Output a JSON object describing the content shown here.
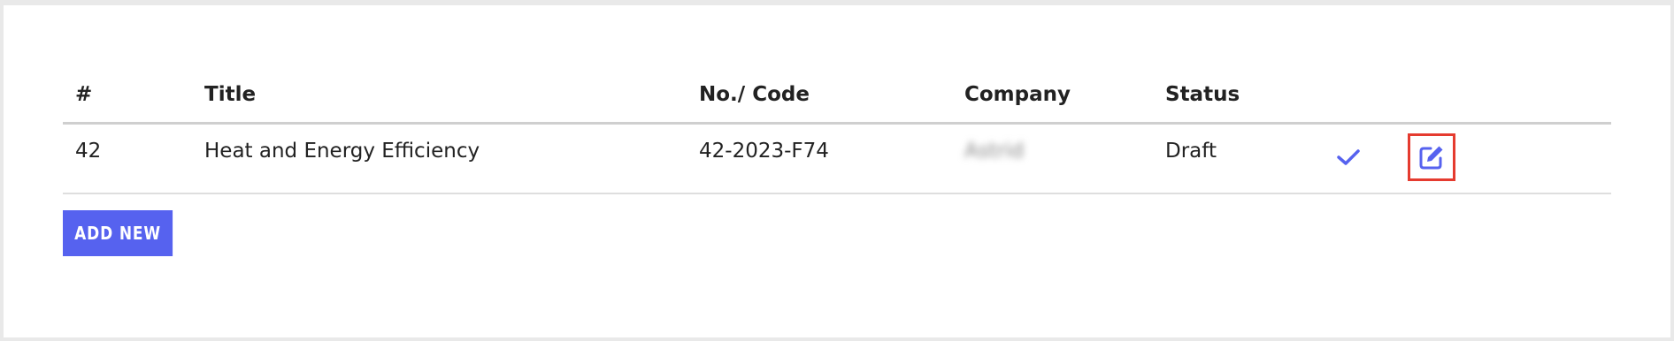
{
  "table": {
    "headers": [
      "#",
      "Title",
      "No./ Code",
      "Company",
      "Status"
    ],
    "rows": [
      {
        "number": "42",
        "title": "Heat and Energy Efficiency",
        "code": "42-2023-F74",
        "company": "Astrid",
        "status": "Draft"
      }
    ]
  },
  "actions": {
    "approve_icon": "check-icon",
    "edit_icon": "edit-icon"
  },
  "add_button": {
    "label": "ADD NEW"
  },
  "colors": {
    "accent": "#5662ef",
    "highlight": "#e53b2f"
  }
}
